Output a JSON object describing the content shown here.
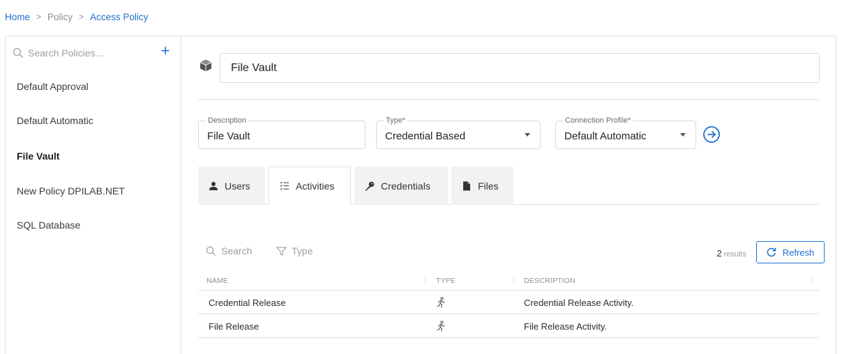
{
  "breadcrumb": {
    "home": "Home",
    "policy": "Policy",
    "current": "Access Policy",
    "separator": ">"
  },
  "sidebar": {
    "search_placeholder": "Search Policies...",
    "add_label": "+",
    "items": [
      {
        "label": "Default Approval"
      },
      {
        "label": "Default Automatic"
      },
      {
        "label": "File Vault"
      },
      {
        "label": "New Policy DPILAB.NET"
      },
      {
        "label": "SQL Database"
      }
    ],
    "active_item": "File Vault"
  },
  "policy": {
    "icon": "cube-icon",
    "name": "File Vault"
  },
  "fields": {
    "description": {
      "label": "Description",
      "value": "File Vault"
    },
    "type": {
      "label": "Type*",
      "value": "Credential Based"
    },
    "connection_profile": {
      "label": "Connection Profile*",
      "value": "Default Automatic"
    }
  },
  "tabs": [
    {
      "label": "Users",
      "icon": "user-icon"
    },
    {
      "label": "Activities",
      "icon": "list-icon"
    },
    {
      "label": "Credentials",
      "icon": "key-icon"
    },
    {
      "label": "Files",
      "icon": "file-icon"
    }
  ],
  "active_tab": "Activities",
  "toolbar": {
    "search_label": "Search",
    "type_label": "Type",
    "results_count": "2",
    "results_label": "results",
    "refresh_label": "Refresh"
  },
  "table": {
    "columns": [
      "NAME",
      "TYPE",
      "DESCRIPTION"
    ],
    "rows": [
      {
        "name": "Credential Release",
        "type_icon": "running-person-icon",
        "description": "Credential Release Activity."
      },
      {
        "name": "File Release",
        "type_icon": "running-person-icon",
        "description": "File Release Activity."
      }
    ]
  },
  "colors": {
    "accent": "#1f6fd1",
    "border": "#e0e0e0",
    "tab_inactive_bg": "#f2f2f2",
    "muted_text": "#9aa0a6"
  }
}
